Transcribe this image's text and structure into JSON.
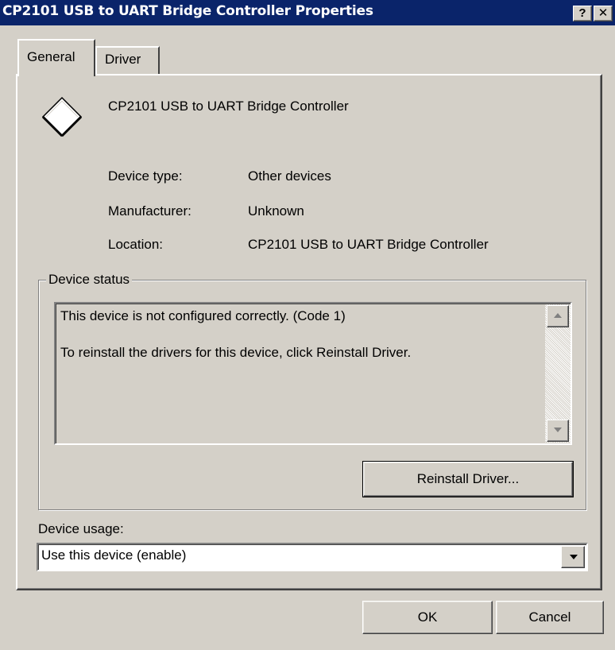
{
  "window": {
    "title": "CP2101 USB to UART Bridge Controller Properties",
    "help_glyph": "?",
    "close_glyph": "✕"
  },
  "tabs": [
    {
      "label": "General",
      "selected": true
    },
    {
      "label": "Driver",
      "selected": false
    }
  ],
  "device": {
    "name": "CP2101 USB to UART Bridge Controller",
    "icon": "unknown-device-diamond-icon",
    "properties": [
      {
        "label": "Device type:",
        "value": "Other devices"
      },
      {
        "label": "Manufacturer:",
        "value": "Unknown"
      },
      {
        "label": "Location:",
        "value": "CP2101 USB to UART Bridge Controller"
      }
    ]
  },
  "device_status": {
    "legend": "Device status",
    "lines": [
      "This device is not configured correctly. (Code 1)",
      "To reinstall the drivers for this device, click Reinstall Driver."
    ],
    "reinstall_label": "Reinstall Driver..."
  },
  "device_usage": {
    "label": "Device usage:",
    "selected": "Use this device (enable)"
  },
  "footer": {
    "ok_label": "OK",
    "cancel_label": "Cancel"
  }
}
